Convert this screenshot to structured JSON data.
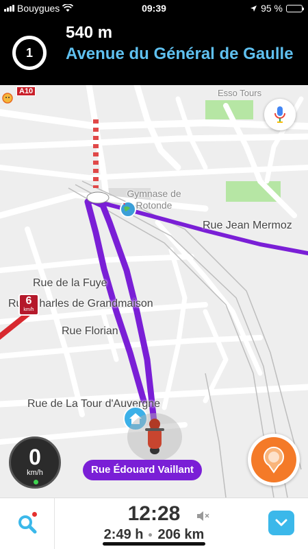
{
  "status_bar": {
    "carrier": "Bouygues",
    "time": "09:39",
    "battery": "95 %",
    "battery_level": 0.95
  },
  "navigation": {
    "exit_number": "1",
    "distance": "540 m",
    "street": "Avenue du Général de Gaulle",
    "turn_icon": "roundabout-icon"
  },
  "map": {
    "labels": {
      "esso": "Esso Tours",
      "gymnase": "Gymnase de Rotonde",
      "jean_mermoz": "Rue Jean Mermoz",
      "fuye": "Rue de la Fuye",
      "grandmaison": "Rue Charles de Grandmaison",
      "florian": "Rue Florian",
      "tour_auvergne": "Rue de La Tour d'Auvergne"
    },
    "road_sign": "A10",
    "speed_limit": {
      "value": "6",
      "unit": "km/h"
    },
    "current_street": "Rue Édouard Vaillant",
    "route_color": "#7a1fd6"
  },
  "speedometer": {
    "value": "0",
    "unit": "km/h"
  },
  "trip": {
    "arrival_time": "12:28",
    "duration": "2:49 h",
    "distance": "206 km"
  },
  "colors": {
    "accent_blue": "#5fc0ef",
    "route": "#7a1fd6",
    "report_orange": "#f47a28",
    "button_blue": "#3bb8ea"
  }
}
